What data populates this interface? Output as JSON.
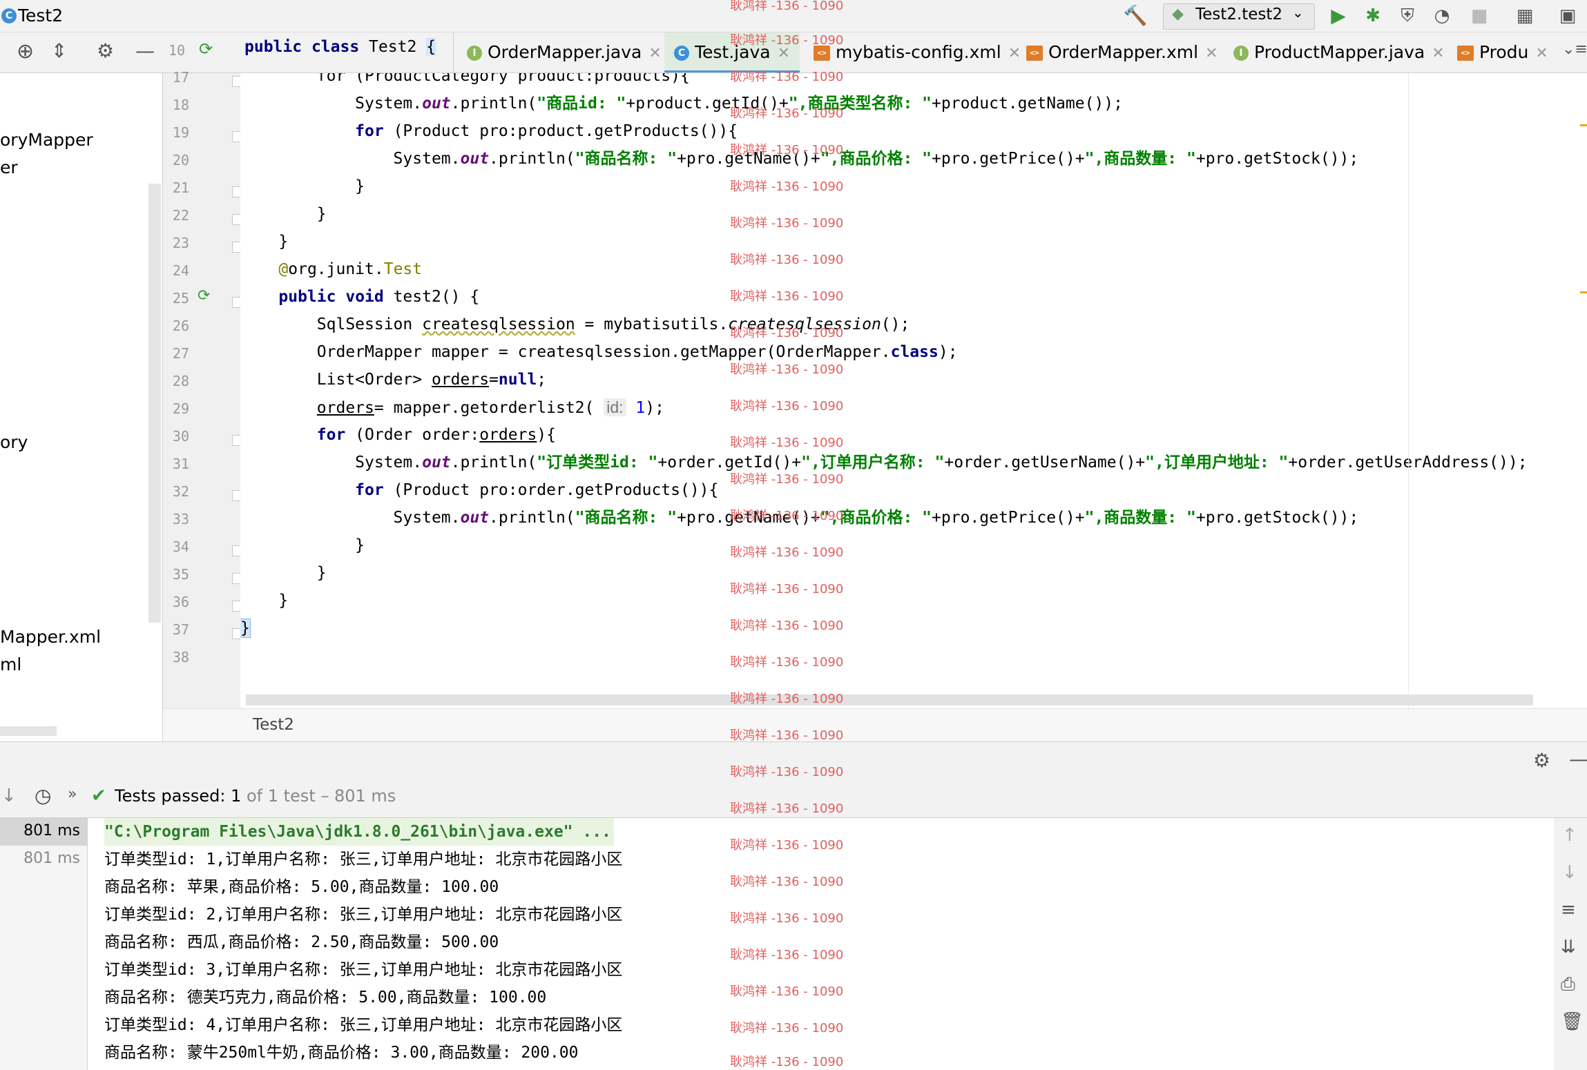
{
  "window": {
    "title": "Test2"
  },
  "toolbar": {
    "run_config": "Test2.test2",
    "icons": [
      "hammer-icon",
      "run-icon",
      "debug-icon",
      "coverage-icon",
      "profile-icon",
      "stop-icon",
      "project-structure-icon",
      "terminal-icon"
    ]
  },
  "editor_header": {
    "line_no": "10",
    "class_decl_kw1": "public",
    "class_decl_kw2": "class",
    "class_decl_name": " Test2 ",
    "class_decl_brace": "{"
  },
  "tabs": [
    {
      "label": "OrderMapper.java",
      "badge": "I"
    },
    {
      "label": "Test.java",
      "badge": "C"
    },
    {
      "label": "mybatis-config.xml",
      "badge": "<>"
    },
    {
      "label": "OrderMapper.xml",
      "badge": "<>"
    },
    {
      "label": "ProductMapper.java",
      "badge": "I"
    },
    {
      "label": "Produ",
      "badge": "<>"
    }
  ],
  "project_items": [
    "oryMapper",
    "er",
    "ory",
    "Mapper.xml",
    "ml"
  ],
  "line_numbers": [
    "17",
    "18",
    "19",
    "20",
    "21",
    "22",
    "23",
    "24",
    "25",
    "26",
    "27",
    "28",
    "29",
    "30",
    "31",
    "32",
    "33",
    "34",
    "35",
    "36",
    "37",
    "38"
  ],
  "code": {
    "l17": "        for (ProductCategory product:products){",
    "l18_a": "            System.",
    "l18_b": "out",
    "l18_c": ".println(",
    "l18_s1": "\"商品id: \"",
    "l18_d": "+product.getId()+",
    "l18_s2": "\",商品类型名称: \"",
    "l18_e": "+product.getName());",
    "l19_kw": "for",
    "l19_rest": " (Product pro:product.getProducts()){",
    "l20_a": "                System.",
    "l20_b": "out",
    "l20_c": ".println(",
    "l20_s1": "\"商品名称: \"",
    "l20_d": "+pro.getName()+",
    "l20_s2": "\",商品价格: \"",
    "l20_e": "+pro.getPrice()+",
    "l20_s3": "\",商品数量: \"",
    "l20_f": "+pro.getStock());",
    "l21": "            }",
    "l22": "        }",
    "l23": "    }",
    "l24_at": "@",
    "l24_a": "org.junit.",
    "l24_b": "Test",
    "l25_kw1": "public",
    "l25_kw2": "void",
    "l25_rest": " test2() {",
    "l26_a": "        SqlSession ",
    "l26_b": "createsqlsession",
    "l26_c": " = mybatisutils.",
    "l26_d": "createsqlsession",
    "l26_e": "();",
    "l27_a": "        OrderMapper mapper = createsqlsession.getMapper(OrderMapper.",
    "l27_kw": "class",
    "l27_b": ");",
    "l28_a": "        List<Order> ",
    "l28_b": "orders",
    "l28_c": "=",
    "l28_kw": "null",
    "l28_d": ";",
    "l29_a": "orders",
    "l29_b": "= mapper.getorderlist2( ",
    "l29_hint": "id:",
    "l29_num": " 1",
    "l29_c": ");",
    "l30_kw": "for",
    "l30_a": " (Order order:",
    "l30_b": "orders",
    "l30_c": "){",
    "l31_a": "            System.",
    "l31_b": "out",
    "l31_c": ".println(",
    "l31_s1": "\"订单类型id: \"",
    "l31_d": "+order.getId()+",
    "l31_s2": "\",订单用户名称: \"",
    "l31_e": "+order.getUserName()+",
    "l31_s3": "\",订单用户地址: \"",
    "l31_f": "+order.getUserAddress());",
    "l32_kw": "for",
    "l32_rest": " (Product pro:order.getProducts()){",
    "l33_a": "                System.",
    "l33_b": "out",
    "l33_c": ".println(",
    "l33_s1": "\"商品名称: \"",
    "l33_d": "+pro.getName()+",
    "l33_s2": "\",商品价格: \"",
    "l33_e": "+pro.getPrice()+",
    "l33_s3": "\",商品数量: \"",
    "l33_f": "+pro.getStock());",
    "l34": "            }",
    "l35": "        }",
    "l36": "    }",
    "l37": "}"
  },
  "breadcrumb": "Test2",
  "run": {
    "status_prefix": "Tests passed: ",
    "passed": "1",
    "status_suffix": " of 1 test – 801 ms",
    "tree": [
      "801 ms",
      "801 ms"
    ],
    "console": [
      "\"C:\\Program Files\\Java\\jdk1.8.0_261\\bin\\java.exe\" ...",
      "订单类型id: 1,订单用户名称: 张三,订单用户地址: 北京市花园路小区",
      "商品名称: 苹果,商品价格: 5.00,商品数量: 100.00",
      "订单类型id: 2,订单用户名称: 张三,订单用户地址: 北京市花园路小区",
      "商品名称: 西瓜,商品价格: 2.50,商品数量: 500.00",
      "订单类型id: 3,订单用户名称: 张三,订单用户地址: 北京市花园路小区",
      "商品名称: 德芙巧克力,商品价格: 5.00,商品数量: 100.00",
      "订单类型id: 4,订单用户名称: 张三,订单用户地址: 北京市花园路小区",
      "商品名称: 蒙牛250ml牛奶,商品价格: 3.00,商品数量: 200.00"
    ]
  },
  "watermark": "耿鸿祥 -136 - 1090"
}
